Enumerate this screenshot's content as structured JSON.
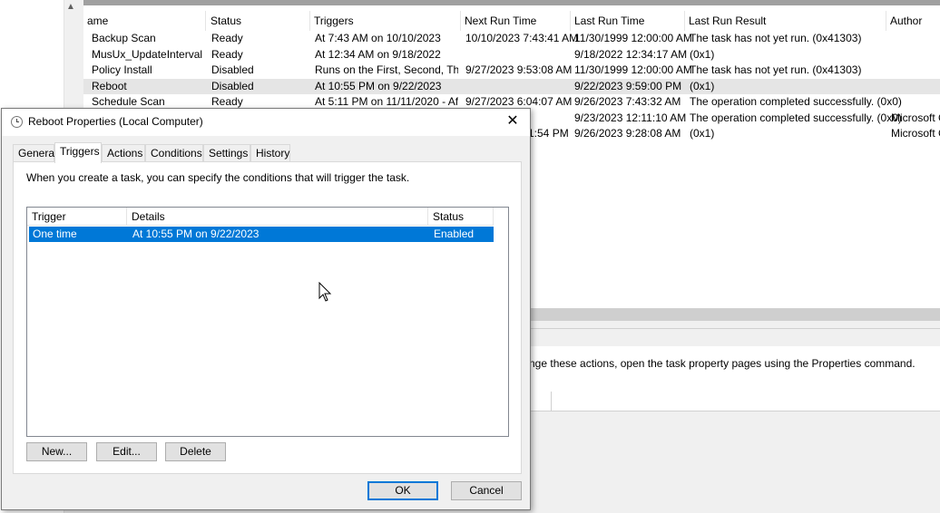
{
  "background": {
    "columns": [
      "ame",
      "Status",
      "Triggers",
      "Next Run Time",
      "Last Run Time",
      "Last Run Result",
      "Author"
    ],
    "rows": [
      {
        "name": "Backup Scan",
        "status": "Ready",
        "triggers": "At 7:43 AM on 10/10/2023",
        "next": "10/10/2023 7:43:41 AM",
        "last": "11/30/1999 12:00:00 AM",
        "result": "The task has not yet run. (0x41303)",
        "author": ""
      },
      {
        "name": "MusUx_UpdateInterval",
        "status": "Ready",
        "triggers": "At 12:34 AM on 9/18/2022",
        "next": "",
        "last": "9/18/2022 12:34:17 AM",
        "result": "(0x1)",
        "author": ""
      },
      {
        "name": "Policy Install",
        "status": "Disabled",
        "triggers": "Runs on the First, Second, Thi...",
        "next": "9/27/2023 9:53:08 AM",
        "last": "11/30/1999 12:00:00 AM",
        "result": "The task has not yet run. (0x41303)",
        "author": ""
      },
      {
        "name": "Reboot",
        "status": "Disabled",
        "triggers": "At 10:55 PM on 9/22/2023",
        "next": "",
        "last": "9/22/2023 9:59:00 PM",
        "result": "(0x1)",
        "author": ""
      },
      {
        "name": "Schedule Scan",
        "status": "Ready",
        "triggers": "At 5:11 PM on 11/11/2020 - Af...",
        "next": "9/27/2023 6:04:07 AM",
        "last": "9/26/2023 7:43:32 AM",
        "result": "The operation completed successfully. (0x0)",
        "author": ""
      },
      {
        "name": "",
        "status": "",
        "triggers": "",
        "next": "",
        "last": "9/23/2023 12:11:10 AM",
        "result": "The operation completed successfully. (0x0)",
        "author": "Microsoft C"
      },
      {
        "name": "",
        "status": "",
        "triggers": "",
        "next": "1:54 PM",
        "last": "9/26/2023 9:28:08 AM",
        "result": "(0x1)",
        "author": "Microsoft C"
      }
    ],
    "lower_text": "nge these actions, open the task property pages using the Properties command."
  },
  "dialog": {
    "title": "Reboot Properties (Local Computer)",
    "close_glyph": "✕",
    "tabs": [
      "General",
      "Triggers",
      "Actions",
      "Conditions",
      "Settings",
      "History"
    ],
    "active_tab": "Triggers",
    "description": "When you create a task, you can specify the conditions that will trigger the task.",
    "list": {
      "columns": [
        "Trigger",
        "Details",
        "Status"
      ],
      "rows": [
        {
          "trigger": "One time",
          "details": "At 10:55 PM on 9/22/2023",
          "status": "Enabled"
        }
      ]
    },
    "buttons": {
      "new": "New...",
      "edit": "Edit...",
      "delete": "Delete",
      "ok": "OK",
      "cancel": "Cancel"
    }
  }
}
